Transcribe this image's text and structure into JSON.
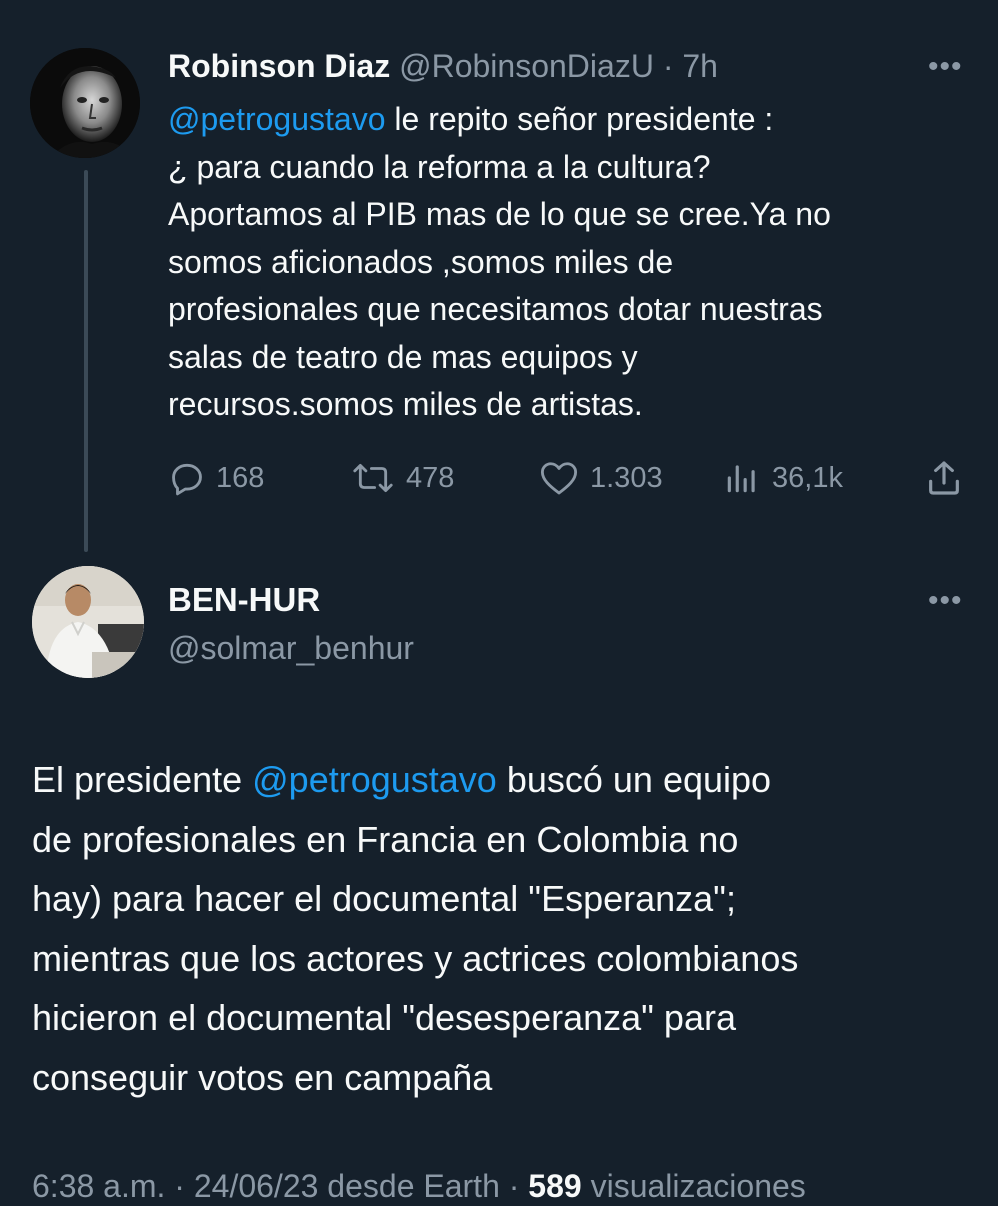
{
  "parent_tweet": {
    "author_name": "Robinson Diaz",
    "author_handle": "@RobinsonDiazU",
    "separator": "·",
    "time": "7h",
    "more_label": "•••",
    "text_lines": [
      {
        "mention": "@petrogustavo",
        "text": "  le repito señor presidente :"
      },
      {
        "mention": "",
        "text": "¿ para cuando la reforma a la cultura?"
      },
      {
        "mention": "",
        "text": "Aportamos al PIB mas de lo que se cree.Ya no"
      },
      {
        "mention": "",
        "text": "somos aficionados ,somos miles de"
      },
      {
        "mention": "",
        "text": "profesionales que necesitamos dotar nuestras"
      },
      {
        "mention": "",
        "text": "salas de teatro de mas equipos y"
      },
      {
        "mention": "",
        "text": "recursos.somos miles de artistas."
      }
    ],
    "stats": {
      "replies": "168",
      "retweets": "478",
      "likes": "1.303",
      "views": "36,1k"
    }
  },
  "reply_tweet": {
    "author_name": "BEN-HUR",
    "author_handle": "@solmar_benhur",
    "more_label": "•••",
    "text_lines": [
      {
        "before": "El presidente ",
        "mention": "@petrogustavo",
        "after": " buscó un equipo"
      },
      {
        "before": "de profesionales en Francia en Colombia no",
        "mention": "",
        "after": ""
      },
      {
        "before": "hay) para hacer el documental \"Esperanza\";",
        "mention": "",
        "after": ""
      },
      {
        "before": "mientras que los actores y actrices colombianos",
        "mention": "",
        "after": ""
      },
      {
        "before": "hicieron el documental \"desesperanza\" para",
        "mention": "",
        "after": ""
      },
      {
        "before": "conseguir votos en campaña",
        "mention": "",
        "after": ""
      }
    ],
    "meta": {
      "time": "6:38 a.m.",
      "sep1": " · ",
      "date": "24/06/23",
      "source": " desde Earth",
      "sep2": " · ",
      "views_count": "589",
      "views_label": " visualizaciones"
    }
  },
  "colors": {
    "background": "#15202b",
    "text": "#f7f9f9",
    "muted": "#8b98a5",
    "mention": "#1d9bf0",
    "thread_line": "#3b4a57"
  },
  "icons": {
    "reply": "reply-icon",
    "retweet": "retweet-icon",
    "like": "heart-icon",
    "views": "analytics-icon",
    "share": "share-icon",
    "more": "more-icon"
  }
}
